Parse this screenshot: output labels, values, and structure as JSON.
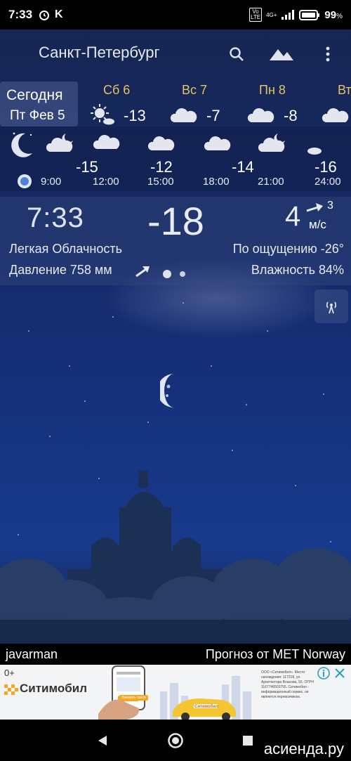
{
  "status_bar": {
    "time": "7:33",
    "carrier_letter": "K",
    "net_badge": "4G+",
    "volte": "Vo LTE",
    "battery": "99",
    "battery_unit": "%"
  },
  "header": {
    "city": "Санкт-Петербург"
  },
  "days": {
    "today_label": "Сегодня",
    "today_date": "Пт Фев 5",
    "items": [
      {
        "name": "Сб 6",
        "temp": "-13",
        "icon": "partly-sunny-icon"
      },
      {
        "name": "Вс 7",
        "temp": "-7",
        "icon": "cloud-icon"
      },
      {
        "name": "Пн 8",
        "temp": "-8",
        "icon": "cloud-icon"
      },
      {
        "name": "Вт",
        "icon": "cloud-icon"
      }
    ]
  },
  "hourly": {
    "temps": [
      "-15",
      "-12",
      "-14",
      "-16"
    ],
    "times": [
      "9:00",
      "12:00",
      "15:00",
      "18:00",
      "21:00",
      "24:00"
    ],
    "icons": [
      "moon-icon",
      "cloud-moon-icon",
      "cloud-icon",
      "cloud-icon",
      "cloud-icon",
      "cloud-moon-icon",
      "moon-cloud-icon"
    ]
  },
  "current": {
    "time": "7:33",
    "temp": "-18",
    "wind_speed": "4",
    "wind_gust": "3",
    "wind_unit": "м/с",
    "condition": "Легкая Облачность",
    "feels_like": "По ощущению -26°",
    "pressure": "Давление 758 мм",
    "humidity": "Влажность 84%"
  },
  "footer": {
    "author": "javarman",
    "source": "Прогноз от MET Norway"
  },
  "ad": {
    "age": "0+",
    "brand": "Ситимобил",
    "car_label": "Ситимобил",
    "button": "Заказать такси",
    "fine_print": "ООО «Ситимобил». Место нахождения: 117218, ул. Архитектора Власова, 55. ОГРН 1167746503755. Ситимобил - информационный сервис, не является перевозчиком."
  },
  "watermark": "асиенда.ру",
  "colors": {
    "day_label": "#e3c46a",
    "sky_top": "#17254f",
    "sky_mid": "#163583"
  }
}
